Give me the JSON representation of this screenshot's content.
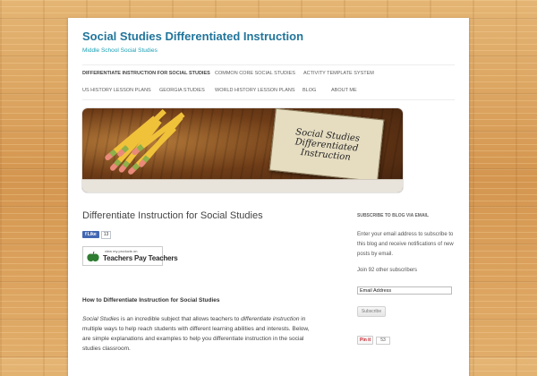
{
  "site": {
    "title": "Social Studies Differentiated Instruction",
    "description": "Middle School Social Studies"
  },
  "nav": {
    "items": [
      {
        "label": "Differentiate Instruction for Social Studies",
        "active": true
      },
      {
        "label": "Common Core Social Studies"
      },
      {
        "label": "Activity Template System"
      },
      {
        "label": "US History Lesson Plans"
      },
      {
        "label": "Georgia Studies"
      },
      {
        "label": "World History Lesson Plans"
      },
      {
        "label": "Blog"
      },
      {
        "label": "About Me"
      }
    ]
  },
  "banner": {
    "lines": [
      "Social Studies",
      "Differentiated",
      "Instruction"
    ]
  },
  "post": {
    "title": "Differentiate Instruction for Social Studies",
    "like_label": "Like",
    "like_count": "13",
    "tpt_small": "view my products on",
    "tpt_big": "Teachers Pay Teachers",
    "heading": "How to Differentiate Instruction for Social Studies",
    "para": {
      "part1": "Social Studies",
      "part2": " is an incredible subject that allows teachers to ",
      "part3": "differentiate instruction",
      "part4": " in multiple ways to help reach students with different learning abilities and interests. Below, are simple explanations and examples to help you differentiate instruction in the social studies classroom."
    }
  },
  "sidebar": {
    "heading": "Subscribe to Blog via Email",
    "text": "Enter your email address to subscribe to this blog and receive notifications of new posts by email.",
    "subscriber_count": "Join 92 other subscribers",
    "email_placeholder": "Email Address",
    "subscribe_label": "Subscribe",
    "pin_label": "Pin it",
    "pin_count": "53"
  },
  "colors": {
    "title_blue": "#21759b",
    "tagline_teal": "#1aa0b5",
    "facebook": "#4267b2",
    "pinterest": "#c8232c"
  }
}
